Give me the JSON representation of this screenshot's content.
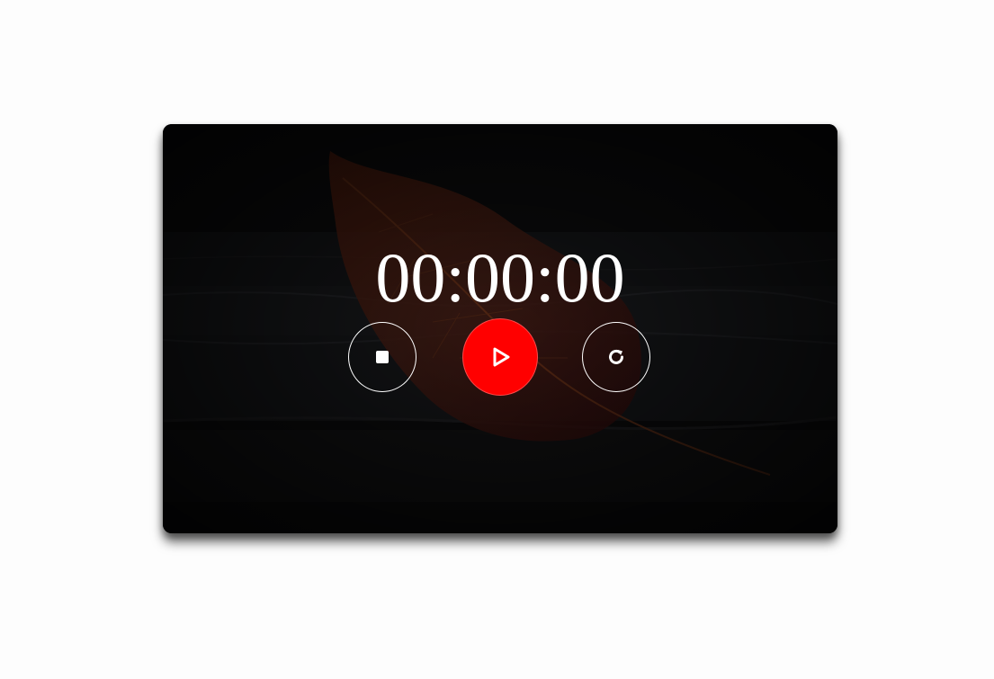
{
  "timer": {
    "display": "00:00:00"
  },
  "controls": {
    "stop_icon": "stop-icon",
    "play_icon": "play-icon",
    "reset_icon": "reset-icon",
    "play_color": "#ff0000"
  },
  "colors": {
    "card_background": "#050505",
    "text": "#ffffff",
    "accent": "#ff0000"
  }
}
